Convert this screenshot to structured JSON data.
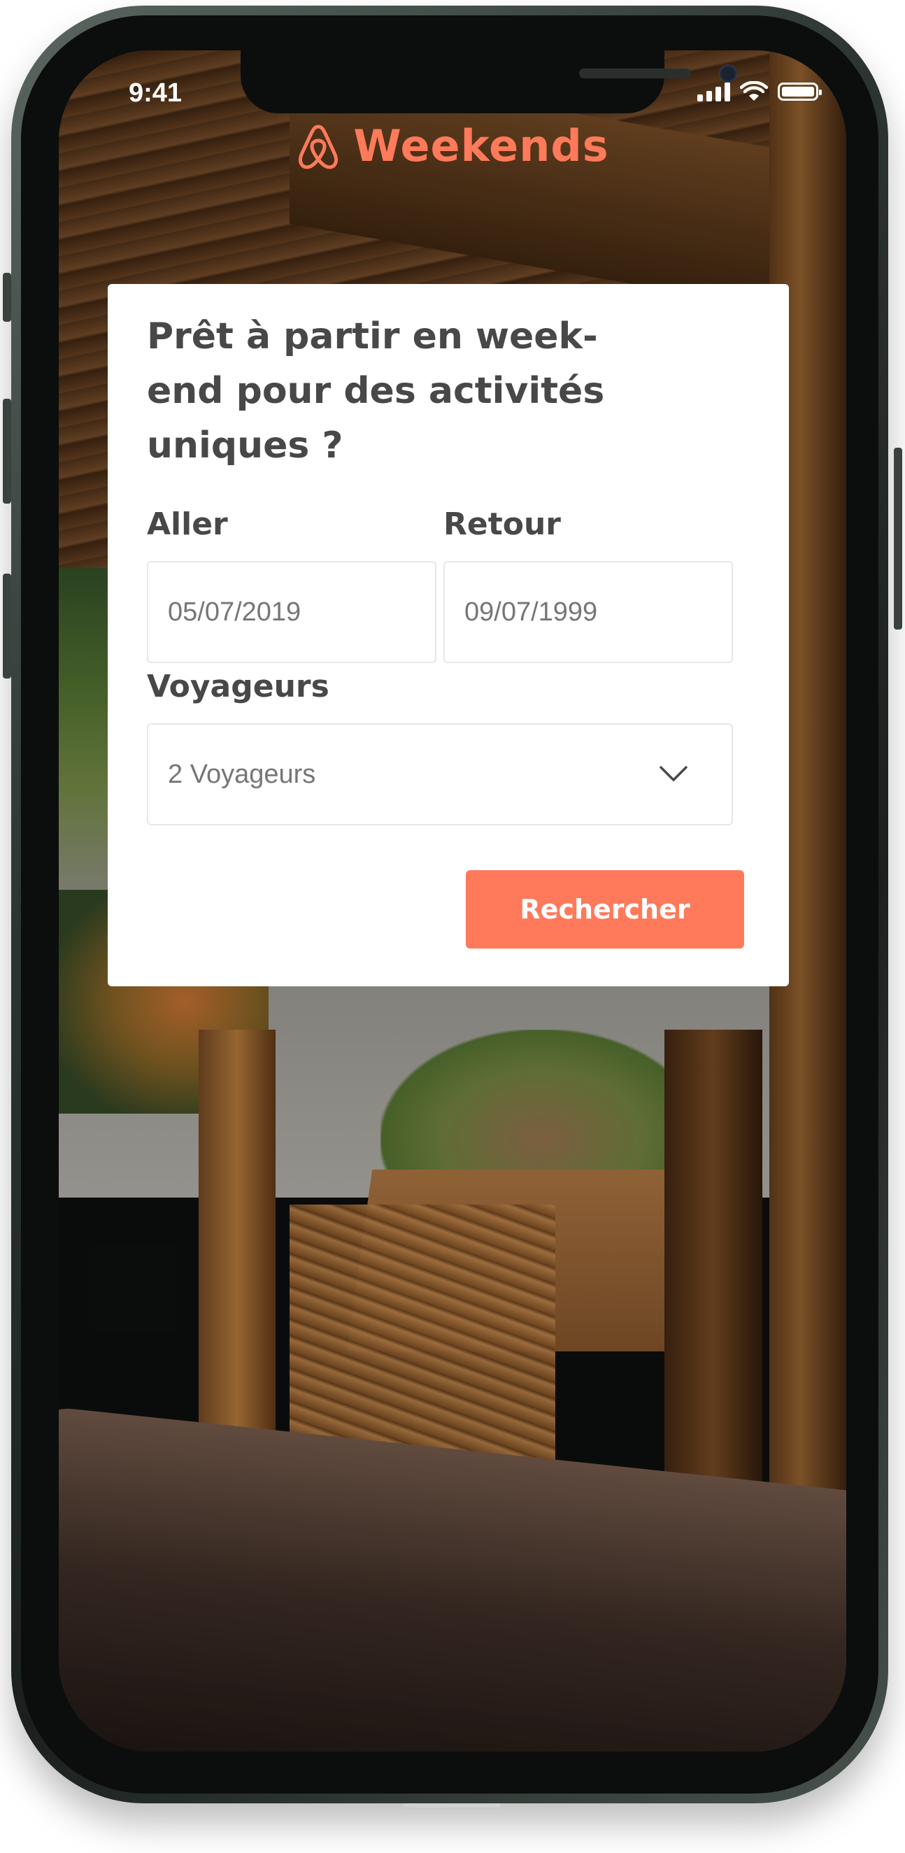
{
  "status_bar": {
    "time": "9:41"
  },
  "brand": {
    "name": "Weekends",
    "logo_icon": "airbnb-belo-icon",
    "color": "#FF7A5A"
  },
  "form": {
    "title": "Prêt à partir en week-end pour des activités uniques ?",
    "depart_label": "Aller",
    "depart_value": "05/07/2019",
    "return_label": "Retour",
    "return_value": "09/07/1999",
    "travelers_label": "Voyageurs",
    "travelers_value": "2 Voyageurs",
    "search_label": "Rechercher"
  },
  "colors": {
    "accent": "#FF7A5A",
    "text": "#484848",
    "muted": "#767676"
  }
}
